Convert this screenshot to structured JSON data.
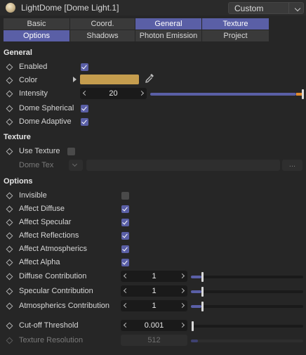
{
  "header": {
    "title": "LightDome [Dome Light.1]",
    "preset": "Custom",
    "icon": "dome-light-icon"
  },
  "tabs_row1": [
    {
      "label": "Basic",
      "active": false
    },
    {
      "label": "Coord.",
      "active": false
    },
    {
      "label": "General",
      "active": true
    },
    {
      "label": "Texture",
      "active": true
    }
  ],
  "tabs_row2": [
    {
      "label": "Options",
      "active": true
    },
    {
      "label": "Shadows",
      "active": false
    },
    {
      "label": "Photon Emission",
      "active": false
    },
    {
      "label": "Project",
      "active": false
    }
  ],
  "general": {
    "title": "General",
    "enabled": {
      "label": "Enabled",
      "checked": true
    },
    "color": {
      "label": "Color",
      "value": "#c59d4e"
    },
    "intensity": {
      "label": "Intensity",
      "value": "20",
      "slider_fraction": 1.0
    },
    "dome_spherical": {
      "label": "Dome Spherical",
      "checked": true
    },
    "dome_adaptive": {
      "label": "Dome Adaptive",
      "checked": true
    }
  },
  "texture": {
    "title": "Texture",
    "use_texture": {
      "label": "Use Texture",
      "checked": false
    },
    "dome_tex": {
      "label": "Dome Tex",
      "browse": "..."
    }
  },
  "options": {
    "title": "Options",
    "invisible": {
      "label": "Invisible",
      "checked": false
    },
    "affect_diffuse": {
      "label": "Affect Diffuse",
      "checked": true
    },
    "affect_specular": {
      "label": "Affect Specular",
      "checked": true
    },
    "affect_reflections": {
      "label": "Affect Reflections",
      "checked": true
    },
    "affect_atmospherics": {
      "label": "Affect Atmospherics",
      "checked": true
    },
    "affect_alpha": {
      "label": "Affect Alpha",
      "checked": true
    },
    "diffuse_contribution": {
      "label": "Diffuse Contribution",
      "value": "1",
      "slider_fraction": 0.1
    },
    "specular_contribution": {
      "label": "Specular Contribution",
      "value": "1",
      "slider_fraction": 0.1
    },
    "atmospherics_contribution": {
      "label": "Atmospherics Contribution",
      "value": "1",
      "slider_fraction": 0.1
    },
    "cutoff_threshold": {
      "label": "Cut-off Threshold",
      "value": "0.001",
      "slider_fraction": 0.0
    },
    "texture_resolution": {
      "label": "Texture Resolution",
      "value": "512",
      "slider_fraction": 0.05
    }
  },
  "colors": {
    "background": "#262626",
    "accent": "#5a5fa6",
    "intensity_marker": "#e08a2c"
  }
}
